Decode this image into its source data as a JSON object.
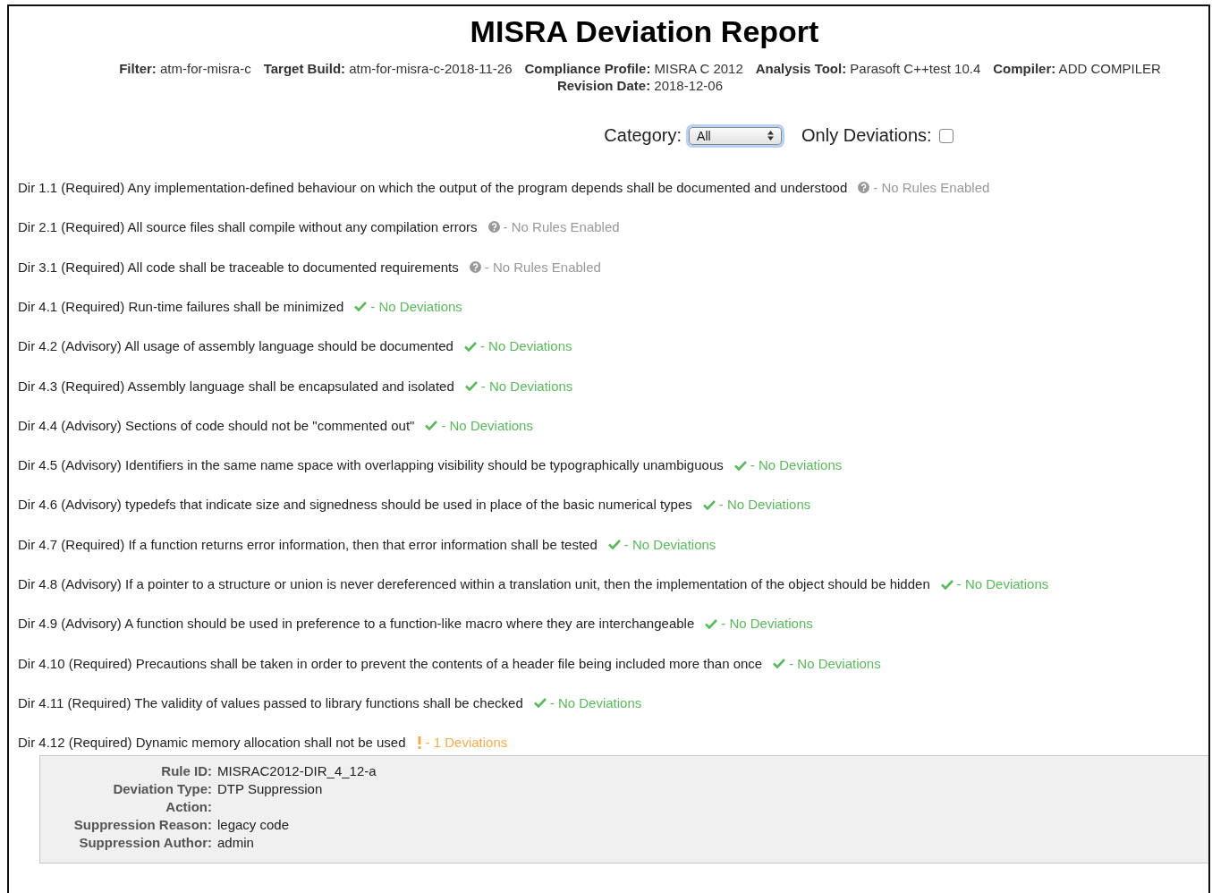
{
  "title": "MISRA Deviation Report",
  "meta": [
    "**Filter:** atm-for-misra-c",
    "**Target Build:** atm-for-misra-c-2018-11-26",
    "**Compliance Profile:** MISRA C 2012",
    "**Analysis Tool:** Parasoft C++test 10.4",
    "**Compiler:** ADD COMPILER",
    "**Revision Date:** 2018-12-06"
  ],
  "filters": {
    "category_label": "Category:",
    "category_value": "All",
    "only_deviations_label": "Only Deviations:",
    "only_deviations_checked": false
  },
  "rules": [
    {
      "text": "Dir 1.1 (Required) Any implementation-defined behaviour on which the output of the program depends shall be documented and understood",
      "kind": "none",
      "status": "- No Rules Enabled"
    },
    {
      "text": "Dir 2.1 (Required) All source files shall compile without any compilation errors",
      "kind": "none",
      "status": "- No Rules Enabled"
    },
    {
      "text": "Dir 3.1 (Required) All code shall be traceable to documented requirements",
      "kind": "none",
      "status": "- No Rules Enabled"
    },
    {
      "text": "Dir 4.1 (Required) Run-time failures shall be minimized",
      "kind": "ok",
      "status": "- No Deviations"
    },
    {
      "text": "Dir 4.2 (Advisory) All usage of assembly language should be documented",
      "kind": "ok",
      "status": "- No Deviations"
    },
    {
      "text": "Dir 4.3 (Required) Assembly language shall be encapsulated and isolated",
      "kind": "ok",
      "status": "- No Deviations"
    },
    {
      "text": "Dir 4.4 (Advisory) Sections of code should not be \"commented out\"",
      "kind": "ok",
      "status": "- No Deviations"
    },
    {
      "text": "Dir 4.5 (Advisory) Identifiers in the same name space with overlapping visibility should be typographically unambiguous",
      "kind": "ok",
      "status": "- No Deviations"
    },
    {
      "text": "Dir 4.6 (Advisory) typedefs that indicate size and signedness should be used in place of the basic numerical types",
      "kind": "ok",
      "status": "- No Deviations"
    },
    {
      "text": "Dir 4.7 (Required) If a function returns error information, then that error information shall be tested",
      "kind": "ok",
      "status": "- No Deviations"
    },
    {
      "text": "Dir 4.8 (Advisory) If a pointer to a structure or union is never dereferenced within a translation unit, then the implementation of the object should be hidden",
      "kind": "ok",
      "status": "- No Deviations"
    },
    {
      "text": "Dir 4.9 (Advisory) A function should be used in preference to a function-like macro where they are interchangeable",
      "kind": "ok",
      "status": "- No Deviations"
    },
    {
      "text": "Dir 4.10 (Required) Precautions shall be taken in order to prevent the contents of a header file being included more than once",
      "kind": "ok",
      "status": "- No Deviations"
    },
    {
      "text": "Dir 4.11 (Required) The validity of values passed to library functions shall be checked",
      "kind": "ok",
      "status": "- No Deviations"
    },
    {
      "text": "Dir 4.12 (Required) Dynamic memory allocation shall not be used",
      "kind": "deviation",
      "status": "- 1 Deviations",
      "details": [
        {
          "label": "Rule ID:",
          "value": "MISRAC2012-DIR_4_12-a"
        },
        {
          "label": "Deviation Type:",
          "value": "DTP Suppression"
        },
        {
          "label": "Action:"
        },
        {
          "label": "Suppression Reason:",
          "value": "legacy code"
        },
        {
          "label": "Suppression Author:",
          "value": "admin"
        }
      ]
    }
  ]
}
